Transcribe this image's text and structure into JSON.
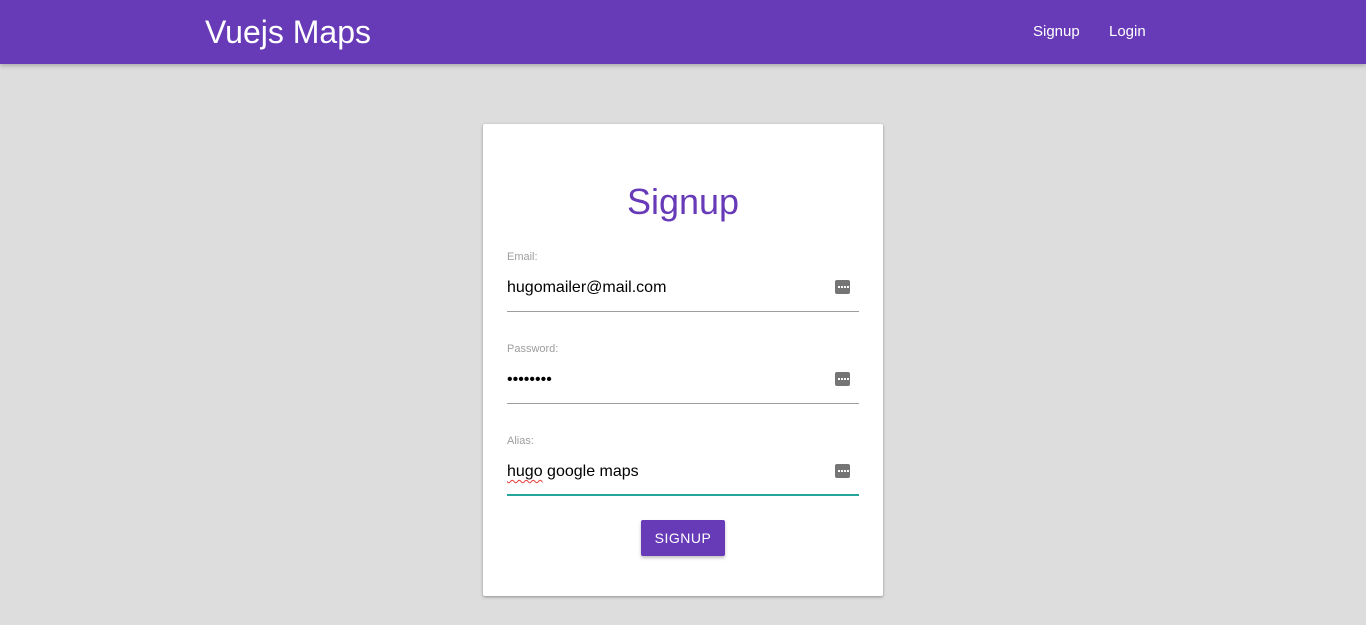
{
  "navbar": {
    "brand": "Vuejs Maps",
    "links": [
      {
        "label": "Signup"
      },
      {
        "label": "Login"
      }
    ]
  },
  "signup_form": {
    "title": "Signup",
    "fields": {
      "email": {
        "label": "Email:",
        "value": "hugomailer@mail.com"
      },
      "password": {
        "label": "Password:",
        "value": "••••••••"
      },
      "alias": {
        "label": "Alias:",
        "value_flagged_word": "hugo",
        "value_rest": " google maps",
        "value": "hugo google maps"
      }
    },
    "submit_label": "SIGNUP"
  },
  "colors": {
    "primary": "#673ab7",
    "background": "#dddddd",
    "active_underline": "#26a69a",
    "label_gray": "#9e9e9e"
  },
  "icons": {
    "autofill": "password-manager-key-icon"
  }
}
